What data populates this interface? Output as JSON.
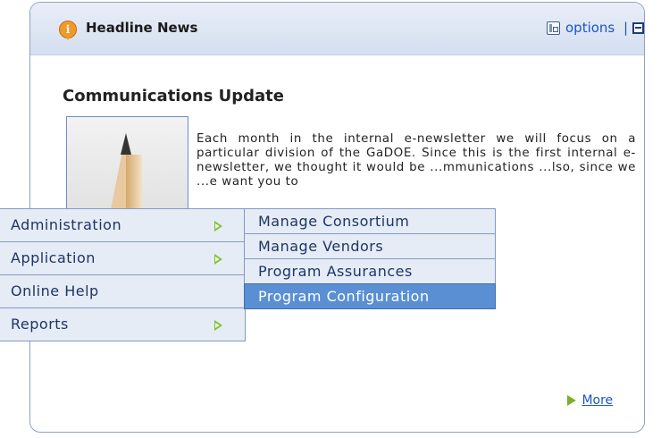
{
  "header": {
    "title": "Headline News",
    "options_label": "options",
    "separator": "|"
  },
  "news": {
    "title": "Communications Update",
    "body": "Each month in the internal e-newsletter we will focus on a particular division of the GaDOE. Since this is the first internal e-newsletter, we thought it would be ...mmunications ...lso, since we ...e want you to",
    "more_label": "More"
  },
  "main_menu": [
    {
      "label": "Administration",
      "has_submenu": true
    },
    {
      "label": "Application",
      "has_submenu": true
    },
    {
      "label": "Online Help",
      "has_submenu": false
    },
    {
      "label": "Reports",
      "has_submenu": true
    }
  ],
  "sub_menu": [
    {
      "label": "Manage Consortium"
    },
    {
      "label": "Manage Vendors"
    },
    {
      "label": "Program Assurances"
    },
    {
      "label": "Program Configuration",
      "active": true
    }
  ],
  "colors": {
    "accent": "#5a8fd3",
    "header_bg": "#dbe4f2",
    "submenu_arrow": "#7fbf35"
  }
}
